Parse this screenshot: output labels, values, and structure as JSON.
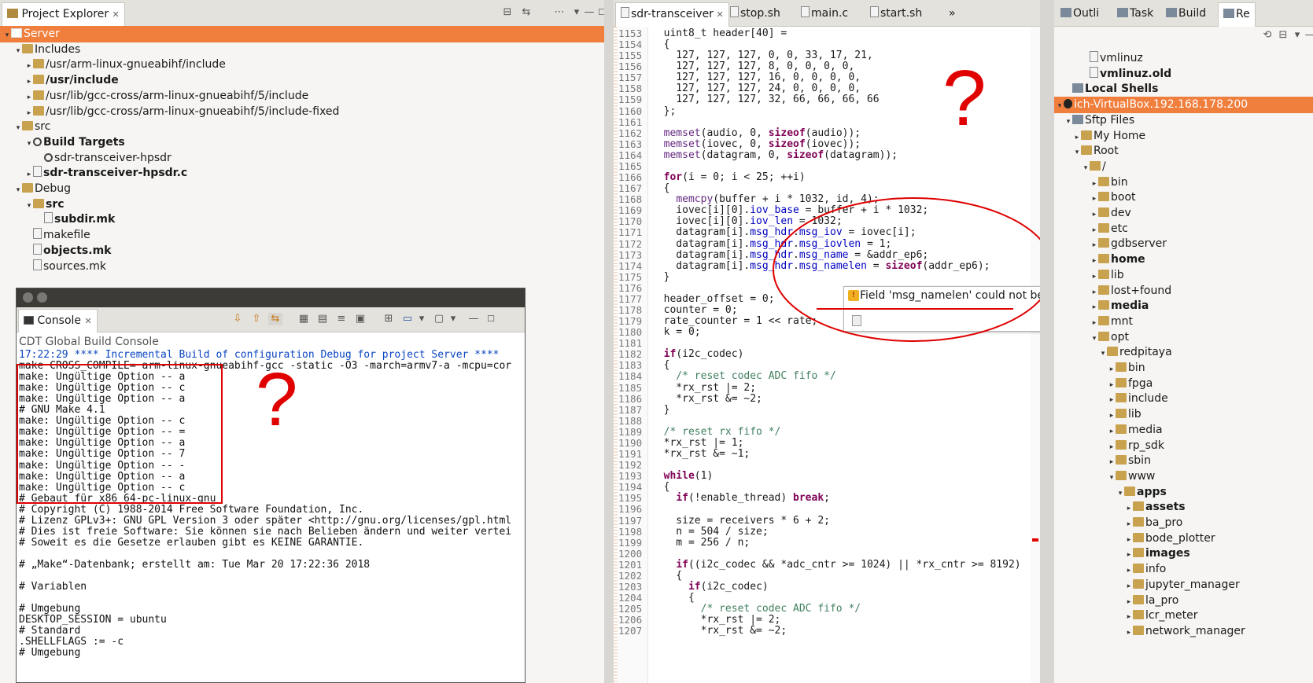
{
  "explorer": {
    "title": "Project Explorer",
    "items": [
      {
        "label": "Server",
        "depth": 0,
        "arrow": "▾",
        "icon": "project-icon",
        "selected": true,
        "bold": false
      },
      {
        "label": "Includes",
        "depth": 1,
        "arrow": "▾",
        "icon": "includes-icon",
        "bold": false
      },
      {
        "label": "/usr/arm-linux-gnueabihf/include",
        "depth": 2,
        "arrow": "▸",
        "icon": "folder-icon",
        "bold": false
      },
      {
        "label": "/usr/include",
        "depth": 2,
        "arrow": "▸",
        "icon": "folder-icon",
        "bold": true
      },
      {
        "label": "/usr/lib/gcc-cross/arm-linux-gnueabihf/5/include",
        "depth": 2,
        "arrow": "▸",
        "icon": "folder-icon",
        "bold": false
      },
      {
        "label": "/usr/lib/gcc-cross/arm-linux-gnueabihf/5/include-fixed",
        "depth": 2,
        "arrow": "▸",
        "icon": "folder-icon",
        "bold": false
      },
      {
        "label": "src",
        "depth": 1,
        "arrow": "▾",
        "icon": "source-folder-icon",
        "bold": false
      },
      {
        "label": "Build Targets",
        "depth": 2,
        "arrow": "▾",
        "icon": "target-icon",
        "bold": true
      },
      {
        "label": "sdr-transceiver-hpsdr",
        "depth": 3,
        "arrow": "",
        "icon": "target-icon",
        "bold": false
      },
      {
        "label": "sdr-transceiver-hpsdr.c",
        "depth": 2,
        "arrow": "▸",
        "icon": "c-file-icon",
        "bold": true
      },
      {
        "label": "Debug",
        "depth": 1,
        "arrow": "▾",
        "icon": "folder-icon",
        "bold": false
      },
      {
        "label": "src",
        "depth": 2,
        "arrow": "▾",
        "icon": "folder-icon",
        "bold": true
      },
      {
        "label": "subdir.mk",
        "depth": 3,
        "arrow": "",
        "icon": "file-icon",
        "bold": true
      },
      {
        "label": "makefile",
        "depth": 2,
        "arrow": "",
        "icon": "file-icon",
        "bold": false
      },
      {
        "label": "objects.mk",
        "depth": 2,
        "arrow": "",
        "icon": "file-icon",
        "bold": true
      },
      {
        "label": "sources.mk",
        "depth": 2,
        "arrow": "",
        "icon": "file-icon",
        "bold": false
      }
    ]
  },
  "console": {
    "title": "Console",
    "subtitle": "CDT Global Build Console",
    "lines": [
      {
        "t": "17:22:29 **** Incremental Build of configuration Debug for project Server ****",
        "c": "#0b46c2"
      },
      {
        "t": "make CROSS_COMPILE= arm-linux-gnueabihf-gcc -static -O3 -march=armv7-a -mcpu=cor",
        "c": "#111"
      },
      {
        "t": "make: Ungültige Option -- a",
        "c": "#111"
      },
      {
        "t": "make: Ungültige Option -- c",
        "c": "#111"
      },
      {
        "t": "make: Ungültige Option -- a",
        "c": "#111"
      },
      {
        "t": "# GNU Make 4.1",
        "c": "#111"
      },
      {
        "t": "make: Ungültige Option -- c",
        "c": "#111"
      },
      {
        "t": "make: Ungültige Option -- =",
        "c": "#111"
      },
      {
        "t": "make: Ungültige Option -- a",
        "c": "#111"
      },
      {
        "t": "make: Ungültige Option -- 7",
        "c": "#111"
      },
      {
        "t": "make: Ungültige Option -- -",
        "c": "#111"
      },
      {
        "t": "make: Ungültige Option -- a",
        "c": "#111"
      },
      {
        "t": "make: Ungültige Option -- c",
        "c": "#111"
      },
      {
        "t": "# Gebaut für x86_64-pc-linux-gnu",
        "c": "#111"
      },
      {
        "t": "# Copyright (C) 1988-2014 Free Software Foundation, Inc.",
        "c": "#111"
      },
      {
        "t": "# Lizenz GPLv3+: GNU GPL Version 3 oder später <http://gnu.org/licenses/gpl.html",
        "c": "#111"
      },
      {
        "t": "# Dies ist freie Software: Sie können sie nach Belieben ändern und weiter vertei",
        "c": "#111"
      },
      {
        "t": "# Soweit es die Gesetze erlauben gibt es KEINE GARANTIE.",
        "c": "#111"
      },
      {
        "t": "",
        "c": "#111"
      },
      {
        "t": "# „Make“-Datenbank; erstellt am: Tue Mar 20 17:22:36 2018",
        "c": "#111"
      },
      {
        "t": "",
        "c": "#111"
      },
      {
        "t": "# Variablen",
        "c": "#111"
      },
      {
        "t": "",
        "c": "#111"
      },
      {
        "t": "# Umgebung",
        "c": "#111"
      },
      {
        "t": "DESKTOP_SESSION = ubuntu",
        "c": "#111"
      },
      {
        "t": "# Standard",
        "c": "#111"
      },
      {
        "t": ".SHELLFLAGS := -c",
        "c": "#111"
      },
      {
        "t": "# Umgebung",
        "c": "#111"
      }
    ]
  },
  "editor": {
    "tabs": [
      {
        "label": "sdr-transceiver",
        "active": true,
        "icon": "c-file-icon"
      },
      {
        "label": "stop.sh",
        "active": false,
        "icon": "file-icon"
      },
      {
        "label": "main.c",
        "active": false,
        "icon": "c-file-icon"
      },
      {
        "label": "start.sh",
        "active": false,
        "icon": "file-icon"
      },
      {
        "label": "»",
        "active": false,
        "icon": ""
      }
    ],
    "first_line": 1153,
    "code": [
      "  uint8_t header[40] =",
      "  {",
      "    127, 127, 127, 0, 0, 33, 17, 21,",
      "    127, 127, 127, 8, 0, 0, 0, 0,",
      "    127, 127, 127, 16, 0, 0, 0, 0,",
      "    127, 127, 127, 24, 0, 0, 0, 0,",
      "    127, 127, 127, 32, 66, 66, 66, 66",
      "  };",
      "",
      "  memset(audio, 0, sizeof(audio));",
      "  memset(iovec, 0, sizeof(iovec));",
      "  memset(datagram, 0, sizeof(datagram));",
      "",
      "  for(i = 0; i < 25; ++i)",
      "  {",
      "    memcpy(buffer + i * 1032, id, 4);",
      "    iovec[i][0].iov_base = buffer + i * 1032;",
      "    iovec[i][0].iov_len = 1032;",
      "    datagram[i].msg_hdr.msg_iov = iovec[i];",
      "    datagram[i].msg_hdr.msg_iovlen = 1;",
      "    datagram[i].msg_hdr.msg_name = &addr_ep6;",
      "    datagram[i].msg_hdr.msg_namelen = sizeof(addr_ep6);",
      "  }",
      "",
      "  header_offset = 0;",
      "  counter = 0;",
      "  rate_counter = 1 << rate;",
      "  k = 0;",
      "",
      "  if(i2c_codec)",
      "  {",
      "    /* reset codec ADC fifo */",
      "    *rx_rst |= 2;",
      "    *rx_rst &= ~2;",
      "  }",
      "",
      "  /* reset rx fifo */",
      "  *rx_rst |= 1;",
      "  *rx_rst &= ~1;",
      "",
      "  while(1)",
      "  {",
      "    if(!enable_thread) break;",
      "",
      "    size = receivers * 6 + 2;",
      "    n = 504 / size;",
      "    m = 256 / n;",
      "",
      "    if((i2c_codec && *adc_cntr >= 1024) || *rx_cntr >= 8192)",
      "    {",
      "      if(i2c_codec)",
      "      {",
      "        /* reset codec ADC fifo */",
      "        *rx_rst |= 2;",
      "        *rx_rst &= ~2;"
    ],
    "tooltip": "Field 'msg_namelen' could not be resolved",
    "question_mark": "?"
  },
  "remote": {
    "tabs": [
      {
        "label": "Outli",
        "icon": "outline-icon"
      },
      {
        "label": "Task",
        "icon": "task-icon"
      },
      {
        "label": "Build",
        "icon": "build-icon"
      },
      {
        "label": "Re",
        "icon": "remote-icon"
      }
    ],
    "items": [
      {
        "label": "vmlinuz",
        "depth": 3,
        "arrow": "",
        "icon": "file-icon",
        "bold": false
      },
      {
        "label": "vmlinuz.old",
        "depth": 3,
        "arrow": "",
        "icon": "file-icon",
        "bold": true
      },
      {
        "label": "Local Shells",
        "depth": 1,
        "arrow": "",
        "icon": "shell-icon",
        "bold": true
      },
      {
        "label": "ich-VirtualBox.192.168.178.200",
        "depth": 0,
        "arrow": "▾",
        "icon": "host-icon",
        "bold": false,
        "selected": true
      },
      {
        "label": "Sftp Files",
        "depth": 1,
        "arrow": "▾",
        "icon": "sftp-icon",
        "bold": false
      },
      {
        "label": "My Home",
        "depth": 2,
        "arrow": "▸",
        "icon": "folder-icon",
        "bold": false
      },
      {
        "label": "Root",
        "depth": 2,
        "arrow": "▾",
        "icon": "folder-icon",
        "bold": false
      },
      {
        "label": "/",
        "depth": 3,
        "arrow": "▾",
        "icon": "folder-icon",
        "bold": false
      },
      {
        "label": "bin",
        "depth": 4,
        "arrow": "▸",
        "icon": "folder-icon",
        "bold": false
      },
      {
        "label": "boot",
        "depth": 4,
        "arrow": "▸",
        "icon": "folder-icon",
        "bold": false
      },
      {
        "label": "dev",
        "depth": 4,
        "arrow": "▸",
        "icon": "folder-icon",
        "bold": false
      },
      {
        "label": "etc",
        "depth": 4,
        "arrow": "▸",
        "icon": "folder-icon",
        "bold": false
      },
      {
        "label": "gdbserver",
        "depth": 4,
        "arrow": "▸",
        "icon": "folder-icon",
        "bold": false
      },
      {
        "label": "home",
        "depth": 4,
        "arrow": "▸",
        "icon": "folder-icon",
        "bold": true
      },
      {
        "label": "lib",
        "depth": 4,
        "arrow": "▸",
        "icon": "folder-icon",
        "bold": false
      },
      {
        "label": "lost+found",
        "depth": 4,
        "arrow": "▸",
        "icon": "folder-icon",
        "bold": false
      },
      {
        "label": "media",
        "depth": 4,
        "arrow": "▸",
        "icon": "folder-icon",
        "bold": true
      },
      {
        "label": "mnt",
        "depth": 4,
        "arrow": "▸",
        "icon": "folder-icon",
        "bold": false
      },
      {
        "label": "opt",
        "depth": 4,
        "arrow": "▾",
        "icon": "folder-icon",
        "bold": false
      },
      {
        "label": "redpitaya",
        "depth": 5,
        "arrow": "▾",
        "icon": "folder-icon",
        "bold": false
      },
      {
        "label": "bin",
        "depth": 6,
        "arrow": "▸",
        "icon": "folder-icon",
        "bold": false
      },
      {
        "label": "fpga",
        "depth": 6,
        "arrow": "▸",
        "icon": "folder-icon",
        "bold": false
      },
      {
        "label": "include",
        "depth": 6,
        "arrow": "▸",
        "icon": "folder-icon",
        "bold": false
      },
      {
        "label": "lib",
        "depth": 6,
        "arrow": "▸",
        "icon": "folder-icon",
        "bold": false
      },
      {
        "label": "media",
        "depth": 6,
        "arrow": "▸",
        "icon": "folder-icon",
        "bold": false
      },
      {
        "label": "rp_sdk",
        "depth": 6,
        "arrow": "▸",
        "icon": "folder-icon",
        "bold": false
      },
      {
        "label": "sbin",
        "depth": 6,
        "arrow": "▸",
        "icon": "folder-icon",
        "bold": false
      },
      {
        "label": "www",
        "depth": 6,
        "arrow": "▾",
        "icon": "folder-icon",
        "bold": false
      },
      {
        "label": "apps",
        "depth": 7,
        "arrow": "▾",
        "icon": "folder-icon",
        "bold": true
      },
      {
        "label": "assets",
        "depth": 8,
        "arrow": "▸",
        "icon": "folder-icon",
        "bold": true
      },
      {
        "label": "ba_pro",
        "depth": 8,
        "arrow": "▸",
        "icon": "folder-icon",
        "bold": false
      },
      {
        "label": "bode_plotter",
        "depth": 8,
        "arrow": "▸",
        "icon": "folder-icon",
        "bold": false
      },
      {
        "label": "images",
        "depth": 8,
        "arrow": "▸",
        "icon": "folder-icon",
        "bold": true
      },
      {
        "label": "info",
        "depth": 8,
        "arrow": "▸",
        "icon": "folder-icon",
        "bold": false
      },
      {
        "label": "jupyter_manager",
        "depth": 8,
        "arrow": "▸",
        "icon": "folder-icon",
        "bold": false
      },
      {
        "label": "la_pro",
        "depth": 8,
        "arrow": "▸",
        "icon": "folder-icon",
        "bold": false
      },
      {
        "label": "lcr_meter",
        "depth": 8,
        "arrow": "▸",
        "icon": "folder-icon",
        "bold": false
      },
      {
        "label": "network_manager",
        "depth": 8,
        "arrow": "▸",
        "icon": "folder-icon",
        "bold": false
      }
    ]
  },
  "colors": {
    "selection": "#f07e3c",
    "annotation": "#e00000",
    "keyword": "#7f0055",
    "field": "#0000c0",
    "comment": "#3f7f5f"
  }
}
